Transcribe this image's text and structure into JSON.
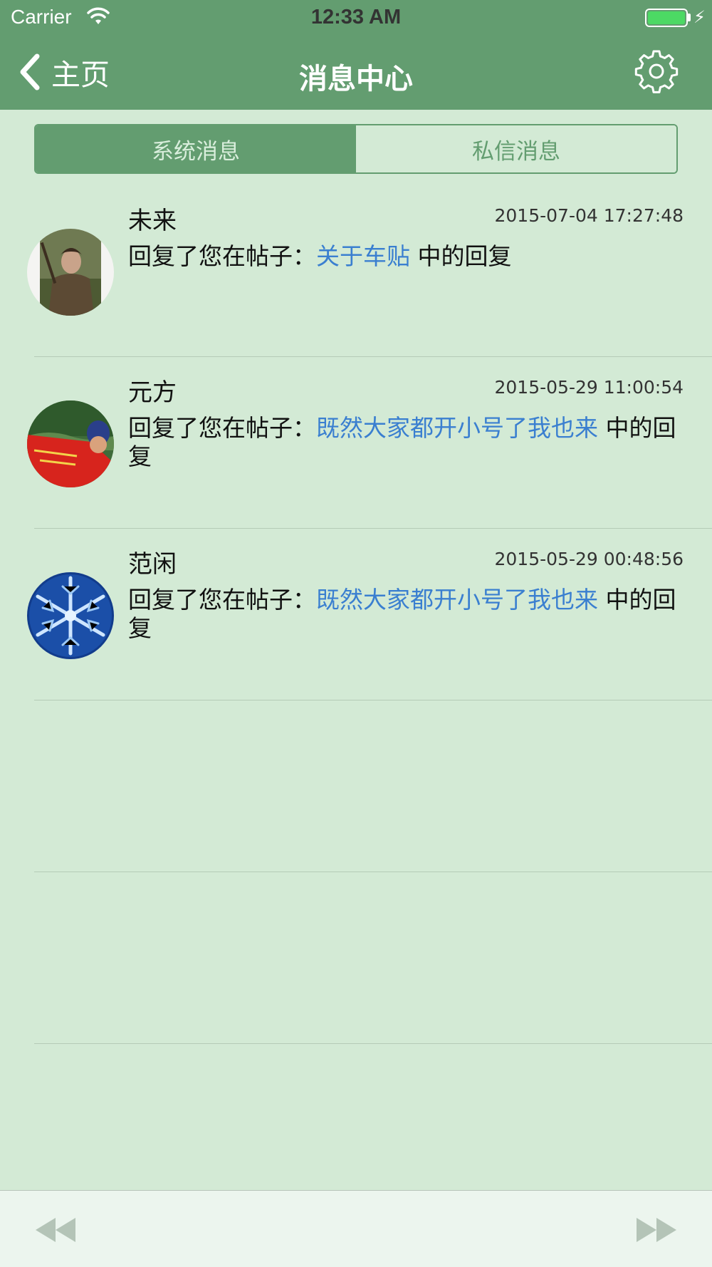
{
  "status_bar": {
    "carrier": "Carrier",
    "time": "12:33 AM",
    "battery_color": "#4cd964"
  },
  "nav": {
    "back_label": "主页",
    "title": "消息中心",
    "back_icon": "chevron-left-icon",
    "settings_icon": "gear-icon",
    "background": "#639d70"
  },
  "segments": [
    {
      "label": "系统消息",
      "selected": true
    },
    {
      "label": "私信消息",
      "selected": false
    }
  ],
  "messages": [
    {
      "name": "未来",
      "time": "2015-07-04 17:27:48",
      "prefix": "回复了您在帖子：",
      "post_title": "关于车贴",
      "suffix": " 中的回复"
    },
    {
      "name": "元方",
      "time": "2015-05-29 11:00:54",
      "prefix": "回复了您在帖子：",
      "post_title": "既然大家都开小号了我也来",
      "suffix": " 中的回复"
    },
    {
      "name": "范闲",
      "time": "2015-05-29 00:48:56",
      "prefix": "回复了您在帖子：",
      "post_title": "既然大家都开小号了我也来",
      "suffix": " 中的回复"
    }
  ],
  "toolbar": {
    "prev_icon": "rewind-icon",
    "next_icon": "fast-forward-icon"
  },
  "colors": {
    "background": "#d3ead5",
    "accent": "#639d70",
    "link": "#3a7fd0"
  }
}
